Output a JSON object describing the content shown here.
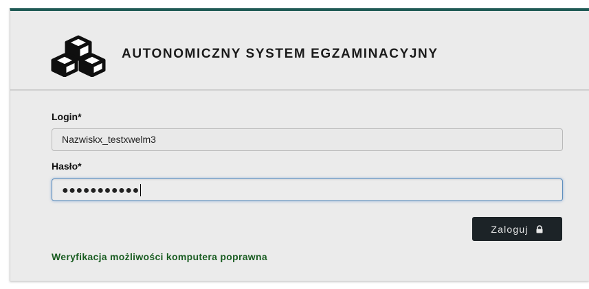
{
  "header": {
    "title": "AUTONOMICZNY SYSTEM EGZAMINACYJNY",
    "logo_icon": "cubes-icon"
  },
  "form": {
    "login_label": "Login*",
    "login_value": "Nazwiskx_testxwelm3",
    "password_label": "Hasło*",
    "password_masked": "●●●●●●●●●●●"
  },
  "login_button": {
    "label": "Zaloguj",
    "icon": "lock-icon"
  },
  "status": {
    "text": "Weryfikacja możliwości komputera poprawna",
    "color": "#1a5d22"
  },
  "colors": {
    "top_bar": "#1f5a55",
    "button_bg": "#1c2327",
    "focus_border": "#5e8fbe"
  }
}
